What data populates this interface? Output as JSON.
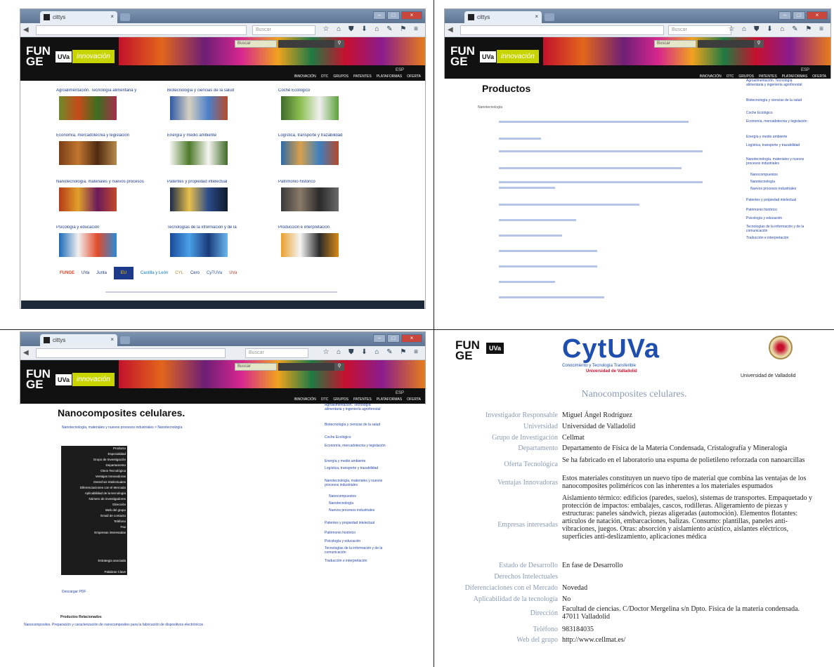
{
  "browser": {
    "tab_title": "cittys",
    "search_placeholder": "Buscar"
  },
  "site": {
    "logo_fun": "FUN",
    "logo_ge": "GE",
    "uva": "UVa",
    "innovation": "innovación",
    "lang_es": "ESP",
    "nav": [
      "Innovación",
      "OTC",
      "Grupos",
      "Patentes",
      "Plataformas",
      "Oferta"
    ]
  },
  "q1": {
    "categories": [
      "Agroalimentación. Tecnología alimentaria y",
      "Biotecnología y ciencias de la salud",
      "Coche Ecológico",
      "Economía, mercadotecnia y legislación",
      "Energía y medio ambiente",
      "Logística, transporte y trazabilidad",
      "Nanotecnología, materiales y nuevos procesos",
      "Patentes y propiedad intelectual",
      "Patrimonio histórico",
      "Psicología y educación",
      "Tecnologías de la información y de la",
      "Producción e interpretación"
    ],
    "partner_logos": [
      "FUNGE",
      "UVa",
      "Junta",
      "EU",
      "Castilla y León",
      "CYL",
      "Cero",
      "CyTUVa",
      "UVa"
    ]
  },
  "q2": {
    "title": "Productos",
    "section": "Nanotecnología",
    "sidebar": [
      "Agroalimentación. Tecnología alimentaria y ingeniería agroforestal",
      "Biotecnología y ciencias de la salud",
      "Coche Ecológico",
      "Economía, mercadotecnia y legislación",
      "Energía y medio ambiente",
      "Logística, transporte y trazabilidad",
      "Nanotecnología, materiales y nuevos procesos industriales",
      "Nanocompuestos",
      "Nanotecnología",
      "Nuevos procesos industriales",
      "Patentes y propiedad intelectual",
      "Patrimonio histórico",
      "Psicología y educación",
      "Tecnologías de la información y de la comunicación",
      "Traducción e interpretación"
    ]
  },
  "q3": {
    "title": "Nanocomposites celulares.",
    "breadcrumb": "Nanotecnología, materiales y nuevos procesos industriales > Nanotecnología",
    "table_keys": [
      "Producto",
      "Especialidad",
      "Grupo de Investigación",
      "Departamento",
      "Otros Tecnológica",
      "Ventajas Innovadoras",
      "Derechos Intelectuales",
      "Diferenciaciones con el Mercado",
      "Aplicabilidad de la tecnología",
      "Número de investigadores",
      "Dirección",
      "Web del grupo",
      "Email de contacto",
      "Teléfono",
      "Fax",
      "Empresas interesadas",
      "Estrategia asociada",
      "Palabras Clave"
    ],
    "back_link": "Descargar PDF",
    "related_heading": "Productos Relacionados",
    "related_link": "Nanocomposites. Preparación y caracterización de nanocomposites para la fabricación de dispositivos electrónicos"
  },
  "q4": {
    "cytuva_logo": "CytUVa",
    "cytuva_tagline": "Conocimiento y Tecnología Transferible",
    "cytuva_sub": "Universidad de Valladolid",
    "univ": "Universidad de Valladolid",
    "title": "Nanocomposites celulares.",
    "rows": [
      {
        "k": "Investigador Responsable",
        "v": "Miguel Ángel Rodríguez"
      },
      {
        "k": "Universidad",
        "v": "Universidad de Valladolid"
      },
      {
        "k": "Grupo de Investigación",
        "v": "Cellmat"
      },
      {
        "k": "Departamento",
        "v": "Departamento de Física de la Materia Condensada, Cristalografía y Mineralogía"
      },
      {
        "k": "Oferta Tecnológica",
        "v": "Se ha fabricado en el laboratorio una espuma de polietileno reforzada con nanoarcillas"
      },
      {
        "k": "Ventajas Innovadoras",
        "v": "Estos materiales constituyen un nuevo tipo de material que combina las ventajas de los nanocomposites poliméricos con las inherentes a los materiales espumados"
      },
      {
        "k": "Empresas interesadas",
        "v": "Aislamiento térmico: edificios (paredes, suelos), sistemas de transportes. Empaquetado y protección de impactos: embalajes, cascos, rodilleras. Aligeramiento de piezas y estructuras: paneles sándwich, piezas aligeradas (automoción). Elementos flotantes: artículos de natación, embarcaciones, balizas. Consumo: plantillas, paneles anti-vibraciones, juegos. Otras: absorción y aislamiento acústico, aislantes eléctricos, superficies anti-deslizamiento, aplicaciones médica"
      },
      {
        "k": "Estado de Desarrollo",
        "v": "En fase de Desarrollo"
      },
      {
        "k": "Derechos Intelectuales",
        "v": ""
      },
      {
        "k": "Diferenciaciones con el Mercado",
        "v": "Novedad"
      },
      {
        "k": "Aplicabilidad de la tecnología",
        "v": "No"
      },
      {
        "k": "Dirección",
        "v": "Facultad de ciencias. C/Doctor Mergelina s/n Dpto. Física de la materia condensada. 47011 Valladolid"
      },
      {
        "k": "Teléfono",
        "v": "983184035"
      },
      {
        "k": "Web del grupo",
        "v": "http://www.cellmat.es/"
      }
    ]
  }
}
